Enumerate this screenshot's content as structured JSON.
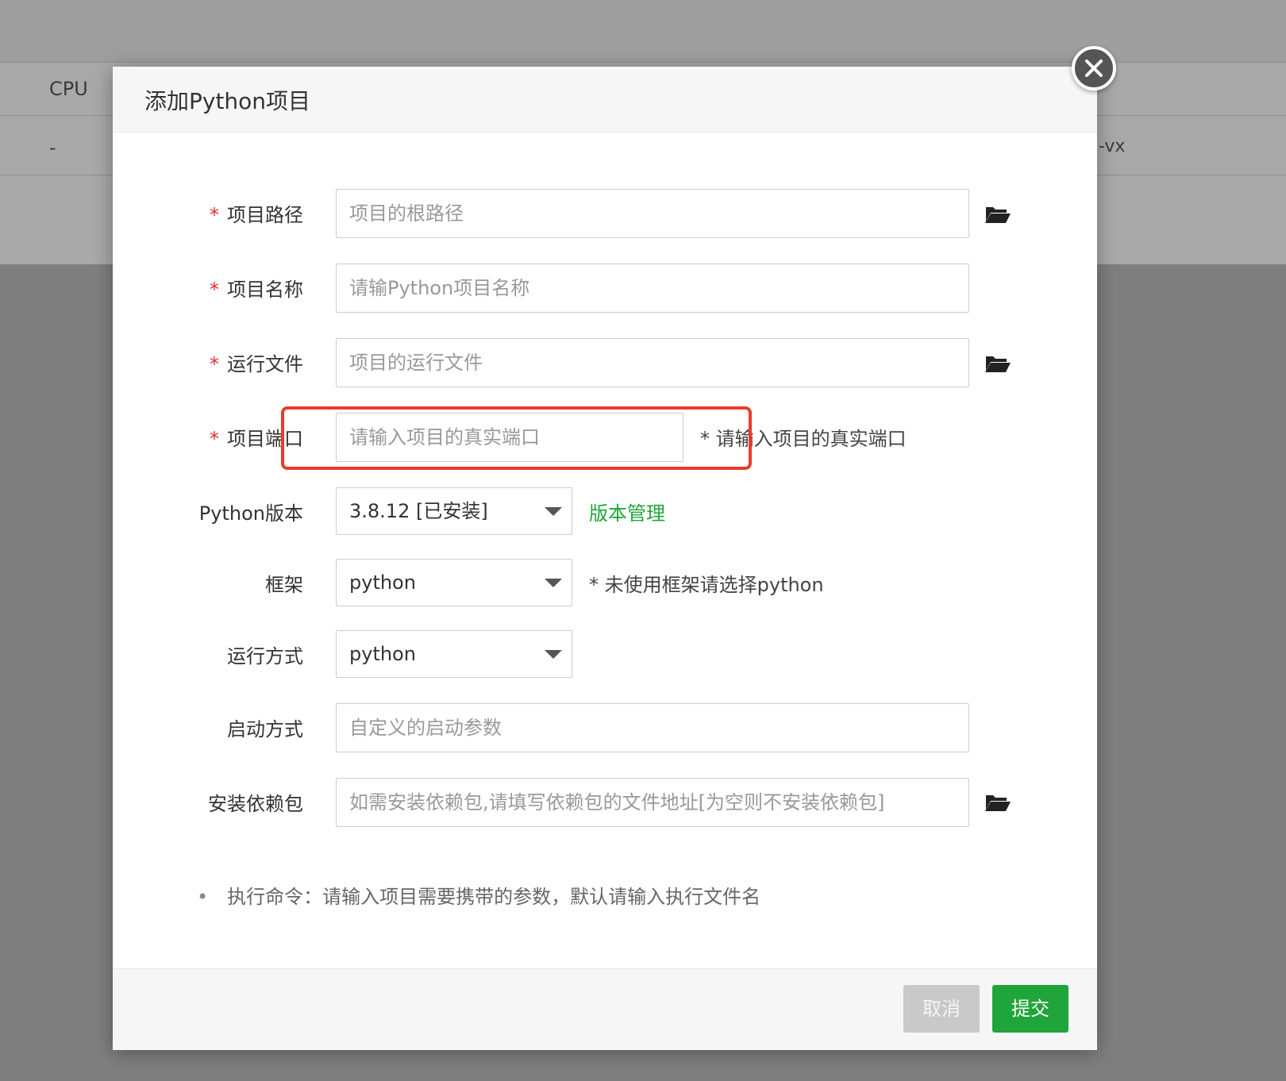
{
  "background": {
    "col_cpu": "CPU",
    "cell_dash": "-",
    "cell_vx": "-vx"
  },
  "dialog": {
    "title": "添加Python项目",
    "close_icon": "close-circle-icon",
    "fields": {
      "project_path": {
        "label": "项目路径",
        "required": true,
        "placeholder": "项目的根路径"
      },
      "project_name": {
        "label": "项目名称",
        "required": true,
        "placeholder": "请输Python项目名称"
      },
      "run_file": {
        "label": "运行文件",
        "required": true,
        "placeholder": "项目的运行文件"
      },
      "project_port": {
        "label": "项目端口",
        "required": true,
        "placeholder": "请输入项目的真实端口",
        "hint": "* 请输入项目的真实端口"
      },
      "python_version": {
        "label": "Python版本",
        "value": "3.8.12 [已安装]",
        "link": "版本管理"
      },
      "framework": {
        "label": "框架",
        "value": "python",
        "hint": "* 未使用框架请选择python"
      },
      "run_mode": {
        "label": "运行方式",
        "value": "python"
      },
      "start_mode": {
        "label": "启动方式",
        "placeholder": "自定义的启动参数"
      },
      "install_deps": {
        "label": "安装依赖包",
        "placeholder": "如需安装依赖包,请填写依赖包的文件地址[为空则不安装依赖包]"
      }
    },
    "note": "执行命令：请输入项目需要携带的参数，默认请输入执行文件名",
    "note_bullet": "•",
    "required_mark": "*",
    "buttons": {
      "cancel": "取消",
      "submit": "提交"
    }
  },
  "colors": {
    "accent_green": "#20a53a",
    "required_red": "#e02f2f",
    "highlight_red": "#e53d2f",
    "overlay": "#7f7f7f"
  }
}
